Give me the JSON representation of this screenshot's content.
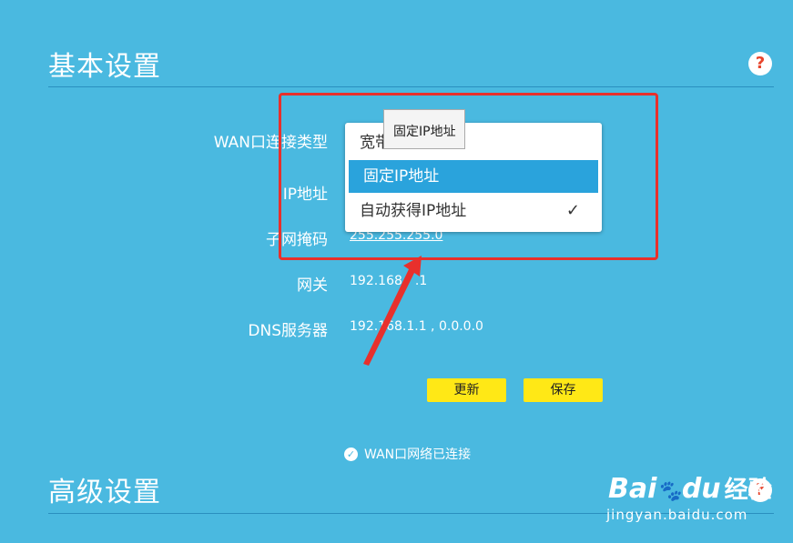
{
  "basic": {
    "title": "基本设置",
    "help": "?"
  },
  "form": {
    "wan_type_label": "WAN口连接类型",
    "ip_label": "IP地址",
    "mask_label": "子网掩码",
    "mask_value": "255.255.255.0",
    "gateway_label": "网关",
    "gateway_value": "192.168",
    "gateway_value_tail": ".1",
    "dns_label": "DNS服务器",
    "dns_value": "192.168.1.1 , 0.0.0.0"
  },
  "dropdown": {
    "options": [
      {
        "label": "宽带",
        "state": "partially-hidden"
      },
      {
        "label": "固定IP地址",
        "state": "highlighted"
      },
      {
        "label": "自动获得IP地址",
        "state": "checked"
      }
    ],
    "check": "✓",
    "tooltip": "固定IP地址"
  },
  "buttons": {
    "refresh": "更新",
    "save": "保存"
  },
  "status": {
    "text": "WAN口网络已连接",
    "icon": "check-circle-icon",
    "check": "✓"
  },
  "advanced": {
    "title": "高级设置",
    "help": "?"
  },
  "watermark": {
    "logo_left": "Bai",
    "logo_du": "du",
    "logo_right": "经验",
    "url": "jingyan.baidu.com"
  },
  "colors": {
    "background": "#4ab9e0",
    "highlight": "#2aa3dc",
    "button": "#ffe816",
    "annotation": "#e8302c",
    "help": "#e8452c"
  }
}
